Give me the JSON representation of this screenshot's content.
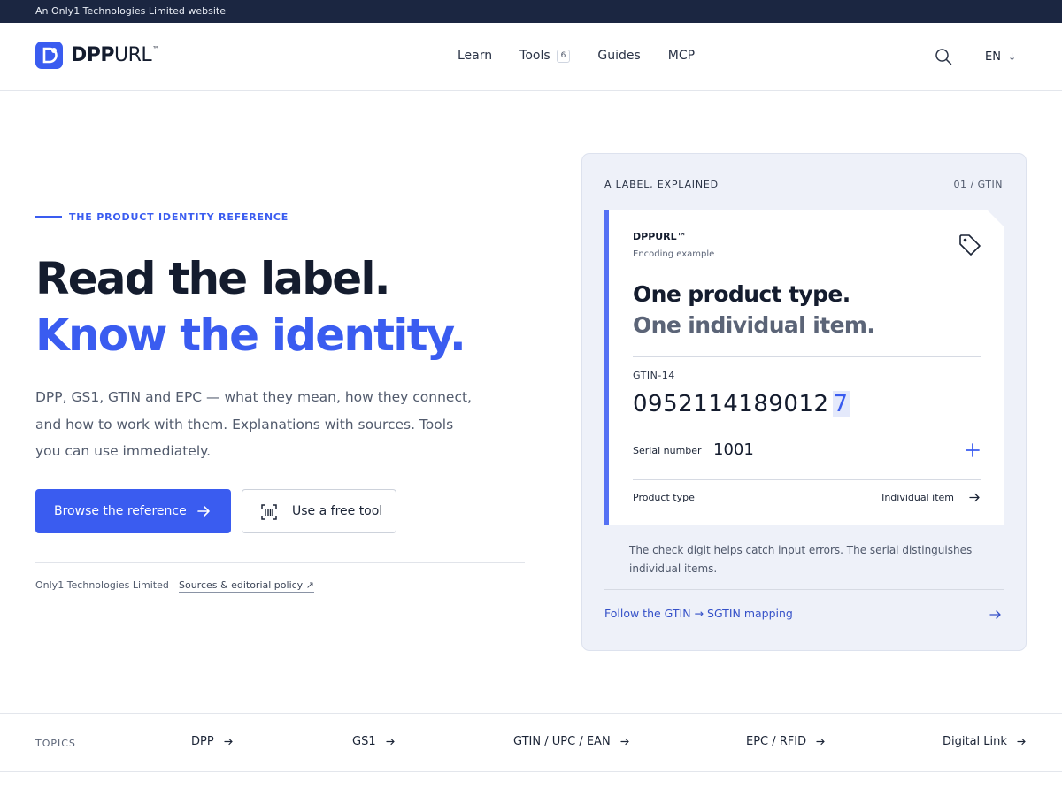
{
  "topbar": {
    "text": "An Only1 Technologies Limited website"
  },
  "header": {
    "logo": {
      "bold": "DPP",
      "light": "URL",
      "tm": "™",
      "mark_letter": "D"
    },
    "nav": [
      {
        "label": "Learn"
      },
      {
        "label": "Tools",
        "badge": "6"
      },
      {
        "label": "Guides"
      },
      {
        "label": "MCP"
      }
    ],
    "lang": "EN",
    "lang_arrow": "↓"
  },
  "hero": {
    "eyebrow": "THE PRODUCT IDENTITY REFERENCE",
    "title_line1": "Read the label.",
    "title_line2": "Know the identity.",
    "subtitle": "DPP, GS1, GTIN and EPC — what they mean, how they connect, and how to work with them. Explanations with sources. Tools you can use immediately.",
    "primary_button": "Browse the reference",
    "secondary_button": "Use a free tool",
    "company": "Only1 Technologies Limited",
    "policy_link": "Sources & editorial policy ↗"
  },
  "panel": {
    "heading": "A LABEL, EXPLAINED",
    "step": "01 / GTIN",
    "card": {
      "brand": "DPPURL™",
      "brand_sub": "Encoding example",
      "headline1": "One product type.",
      "headline2": "One individual item.",
      "gtin_label": "GTIN-14",
      "gtin_body": "0952114189012",
      "gtin_check": "7",
      "serial_label": "Serial number",
      "serial_value": "1001",
      "product_type_label": "Product type",
      "product_type_value": "Individual item"
    },
    "note": "The check digit helps catch input errors. The serial distinguishes individual items.",
    "link": "Follow the GTIN → SGTIN mapping"
  },
  "topics": {
    "label": "TOPICS",
    "items": [
      "DPP",
      "GS1",
      "GTIN / UPC / EAN",
      "EPC / RFID",
      "Digital Link"
    ]
  },
  "colors": {
    "accent": "#3a5cf0",
    "navy": "#1b2641",
    "panel_bg": "#eef1f9"
  }
}
